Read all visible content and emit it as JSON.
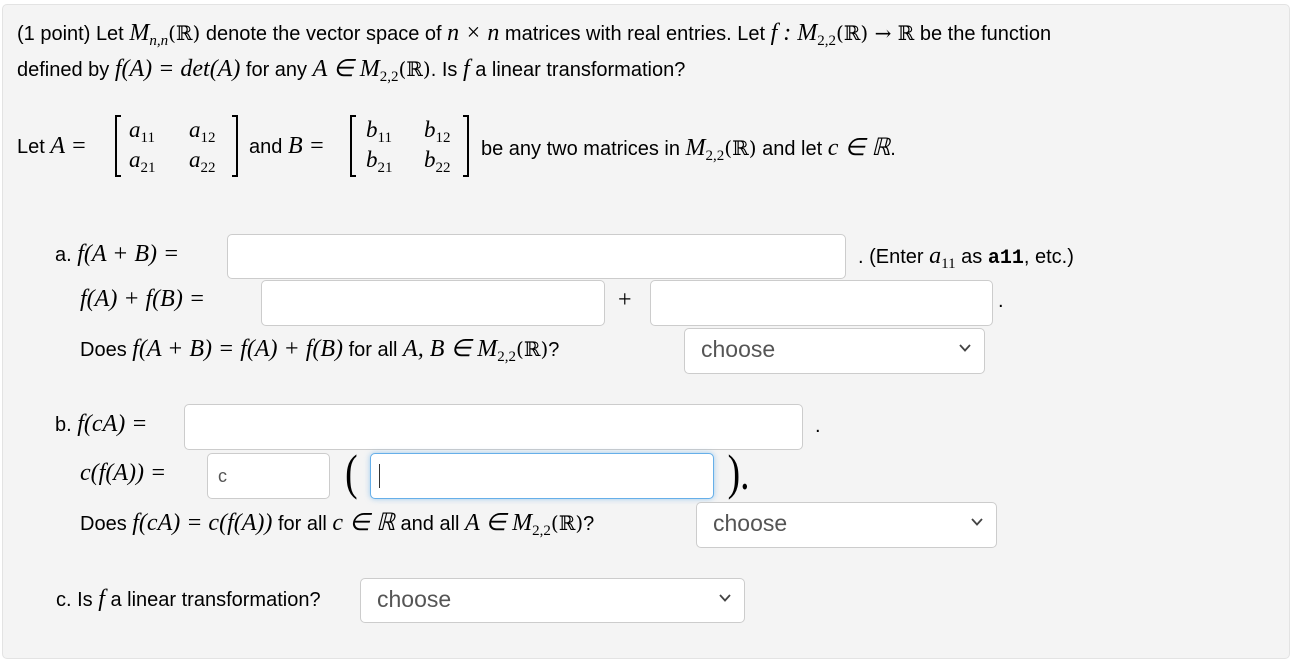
{
  "problem": {
    "points": "(1 point)",
    "intro_line1": [
      "Let",
      "M",
      "n,n",
      "(ℝ)",
      "denote the vector space of",
      "n × n",
      "matrices with real entries. Let",
      "f : M",
      "2,2",
      "(ℝ) → ℝ",
      "be the function"
    ],
    "intro_line2": [
      "defined by",
      "f(A) = det(A)",
      "for any",
      "A ∈ M",
      "2,2",
      "(ℝ)",
      ". Is",
      "f",
      "a linear transformation?"
    ],
    "let_line": {
      "let": "Let",
      "A_eq": "A =",
      "and": "and",
      "B_eq": "B =",
      "tail": "be any two matrices in",
      "M": "M",
      "sub": "2,2",
      "R": "(ℝ)",
      "and_let": "and let",
      "c_in_R": "c ∈ ℝ",
      "period": "."
    },
    "matrix_A": [
      [
        "a",
        "11",
        "a",
        "12"
      ],
      [
        "a",
        "21",
        "a",
        "22"
      ]
    ],
    "matrix_B": [
      [
        "b",
        "11",
        "b",
        "12"
      ],
      [
        "b",
        "21",
        "b",
        "22"
      ]
    ]
  },
  "part_a": {
    "label": "a.",
    "expr1": "f(A + B) =",
    "input1_value": "",
    "hint_prefix": ". (Enter",
    "hint_var": "a",
    "hint_sub": "11",
    "hint_as": "as",
    "hint_code": "a11",
    "hint_suffix": ", etc.)",
    "expr2": "f(A) + f(B) =",
    "input2_value": "",
    "plus": "+",
    "input3_value": "",
    "period": ".",
    "question_prefix": "Does",
    "question_expr": "f(A + B) = f(A) + f(B)",
    "question_for_all": "for all",
    "question_vars": "A, B ∈ M",
    "question_sub": "2,2",
    "question_R": "(ℝ)",
    "question_mark": "?",
    "select_value": "choose"
  },
  "part_b": {
    "label": "b.",
    "expr1": "f(cA) =",
    "input1_value": "",
    "period1": ".",
    "expr2": "c(f(A)) =",
    "input_c_value": "c",
    "open_paren": "(",
    "input_inner_value": "",
    "close_paren": ").",
    "question_prefix": "Does",
    "question_expr": "f(cA) = c(f(A))",
    "question_for_all": "for all",
    "question_c": "c ∈ ℝ",
    "question_and_all": "and all",
    "question_A": "A ∈ M",
    "question_sub": "2,2",
    "question_R": "(ℝ)",
    "question_mark": "?",
    "select_value": "choose"
  },
  "part_c": {
    "label": "c. Is",
    "f": "f",
    "rest": "a linear transformation?",
    "select_value": "choose"
  }
}
